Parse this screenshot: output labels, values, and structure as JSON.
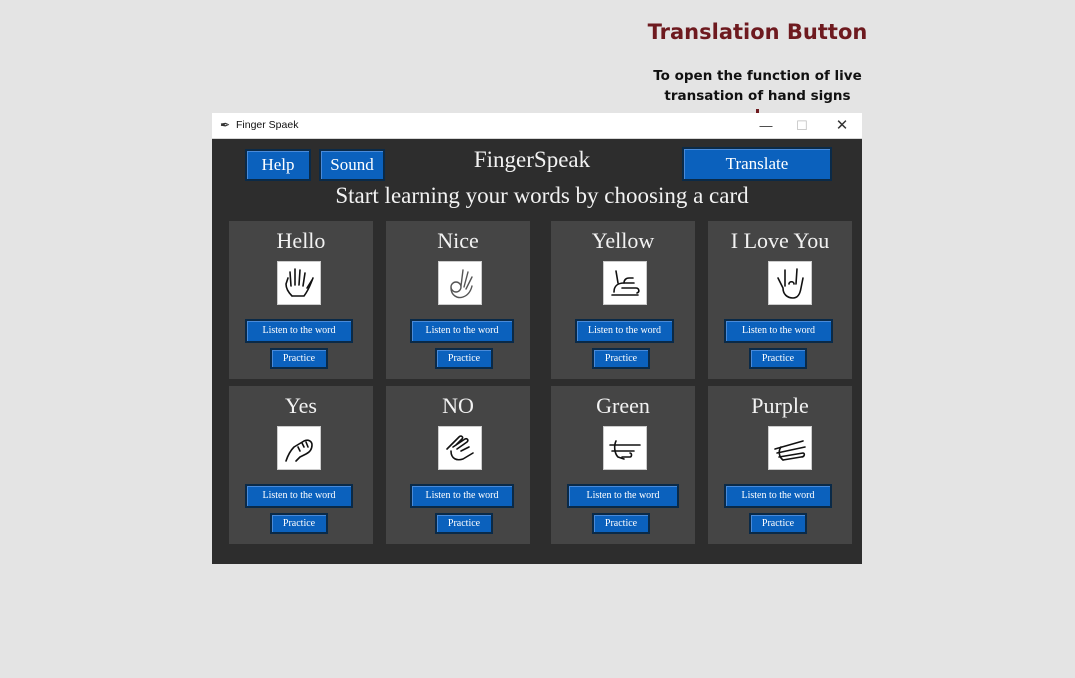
{
  "annotation": {
    "title": "Translation Button",
    "description": "To open the function of live transation of hand signs"
  },
  "window": {
    "title": "Finger Spaek",
    "controls": {
      "minimize": "—",
      "maximize": "☐",
      "close": "✕"
    }
  },
  "header": {
    "help_label": "Help",
    "sound_label": "Sound",
    "app_title": "FingerSpeak",
    "translate_label": "Translate",
    "subtitle": "Start learning your words by choosing a card"
  },
  "cards": [
    {
      "word": "Hello",
      "icon": "open-hand-icon",
      "listen_label": "Listen to the word",
      "practice_label": "Practice"
    },
    {
      "word": "Nice",
      "icon": "ok-hand-icon",
      "listen_label": "Listen to the word",
      "practice_label": "Practice"
    },
    {
      "word": "Yellow",
      "icon": "hand-sign-yellow-icon",
      "listen_label": "Listen to the word",
      "practice_label": "Practice"
    },
    {
      "word": "I Love You",
      "icon": "love-you-hand-icon",
      "listen_label": "Listen to the word",
      "practice_label": "Practice"
    },
    {
      "word": "Yes",
      "icon": "fist-hand-icon",
      "listen_label": "Listen to the word",
      "practice_label": "Practice"
    },
    {
      "word": "NO",
      "icon": "hand-sign-no-icon",
      "listen_label": "Listen to the word",
      "practice_label": "Practice"
    },
    {
      "word": "Green",
      "icon": "pointing-hand-icon",
      "listen_label": "Listen to the word",
      "practice_label": "Practice"
    },
    {
      "word": "Purple",
      "icon": "flat-hand-icon",
      "listen_label": "Listen to the word",
      "practice_label": "Practice"
    }
  ],
  "colors": {
    "annotation": "#6e1a1f",
    "button": "#0b61bd",
    "window_bg": "#2d2d2d",
    "card_bg": "#454545"
  }
}
